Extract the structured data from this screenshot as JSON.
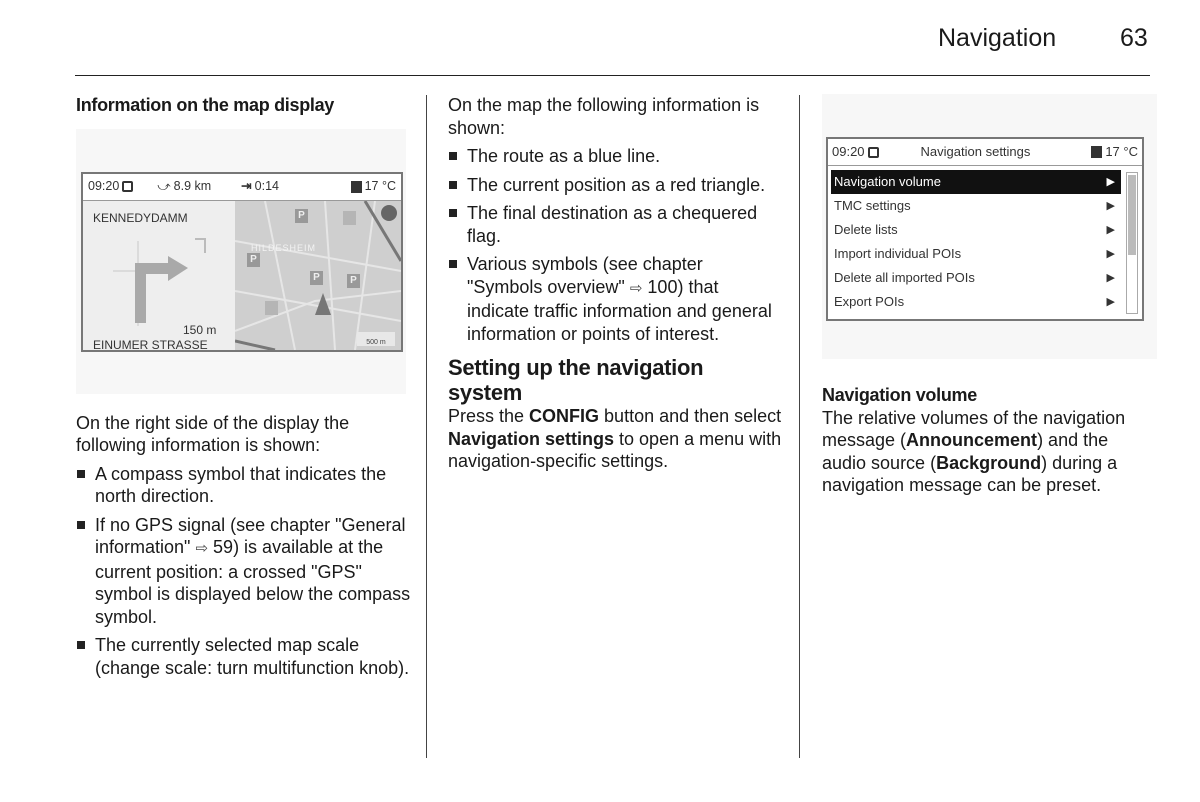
{
  "header": {
    "title": "Navigation",
    "page_number": "63"
  },
  "col1": {
    "heading": "Information on the map display",
    "map_screen": {
      "status": {
        "time": "09:20",
        "distance": "8.9  km",
        "eta": "0:14",
        "temperature": "17 °C"
      },
      "next_street": "KENNEDYDAMM",
      "current_street": "EINUMER STRASSE",
      "turn_distance": "150 m",
      "city_label": "HILDESHEIM",
      "map_scale": "500 m",
      "poi_label": "P"
    },
    "intro": "On the right side of the display the following information is shown:",
    "bullets": [
      {
        "text": "A compass symbol that indicates the north direction."
      },
      {
        "pre": "If no GPS signal (see chapter \"General information\" ",
        "ref": "59",
        "post": ") is available at the current position: a crossed \"GPS\" symbol is displayed below the compass symbol."
      },
      {
        "text": "The currently selected map scale (change scale: turn multifunction knob)."
      }
    ]
  },
  "col2": {
    "intro": "On the map the following information is shown:",
    "bullets": [
      {
        "text": "The route as a blue line."
      },
      {
        "text": "The current position as a red triangle."
      },
      {
        "text": "The final destination as a chequered flag."
      },
      {
        "pre": "Various symbols (see chapter \"Symbols overview\" ",
        "ref": "100",
        "post": ") that indicate traffic information and general information or points of interest."
      }
    ],
    "section_heading": "Setting up the navigation system",
    "para": {
      "t1": "Press the ",
      "b1": "CONFIG",
      "t2": " button and then select ",
      "b2": "Navigation settings",
      "t3": " to open a menu with navigation-specific settings."
    }
  },
  "col3": {
    "settings_screen": {
      "time": "09:20",
      "title": "Navigation settings",
      "temperature": "17 °C",
      "items": [
        {
          "label": "Navigation volume",
          "selected": true
        },
        {
          "label": "TMC settings"
        },
        {
          "label": "Delete lists"
        },
        {
          "label": "Import individual POIs"
        },
        {
          "label": "Delete all imported POIs"
        },
        {
          "label": "Export POIs"
        }
      ],
      "chevron": "▶"
    },
    "subheading": "Navigation volume",
    "para": {
      "t1": "The relative volumes of the navigation message (",
      "b1": "Announcement",
      "t2": ") and the audio source (",
      "b2": "Background",
      "t3": ") during a navigation message can be preset."
    }
  },
  "icons": {
    "xref_arrow": "⇨",
    "bullet": "■"
  }
}
